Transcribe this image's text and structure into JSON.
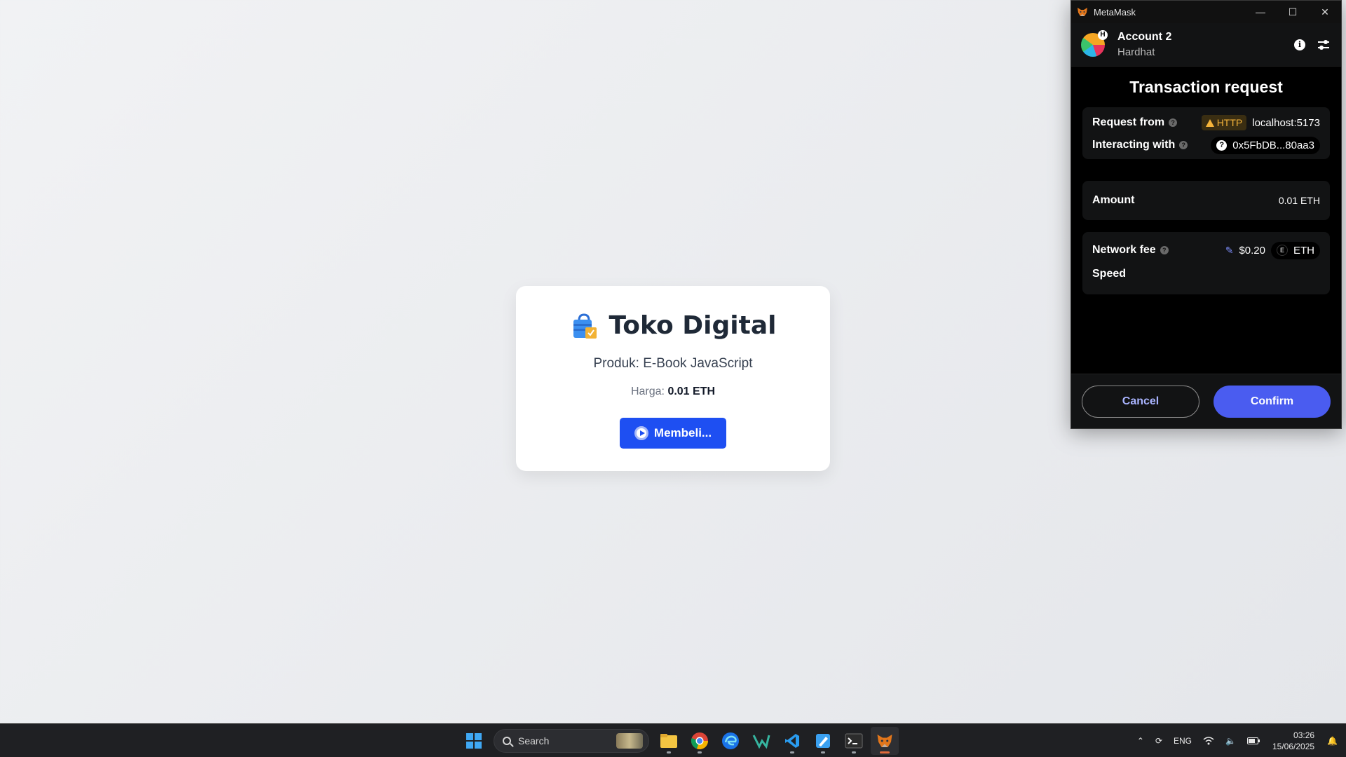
{
  "shop": {
    "title": "Toko Digital",
    "product_label": "Produk: E-Book JavaScript",
    "price_label": "Harga:",
    "price_value": "0.01 ETH",
    "buy_button_label": "Membeli..."
  },
  "metamask": {
    "window_title": "MetaMask",
    "account_name": "Account 2",
    "network_name": "Hardhat",
    "avatar_badge": "H",
    "heading": "Transaction request",
    "request_from_label": "Request from",
    "http_badge": "HTTP",
    "origin": "localhost:5173",
    "interacting_with_label": "Interacting with",
    "contract_address": "0x5FbDB...80aa3",
    "amount_label": "Amount",
    "amount_value": "0.01 ETH",
    "network_fee_label": "Network fee",
    "network_fee_value": "$0.20",
    "fee_token_letter": "E",
    "fee_token": "ETH",
    "speed_label": "Speed",
    "cancel_label": "Cancel",
    "confirm_label": "Confirm"
  },
  "taskbar": {
    "search_placeholder": "Search",
    "language": "ENG",
    "time": "03:26",
    "date": "15/06/2025",
    "apps": [
      "start-icon",
      "file-explorer-icon",
      "chrome-icon",
      "edge-icon",
      "visual-studio-icon",
      "vscode-icon",
      "paint-icon",
      "terminal-icon",
      "metamask-icon"
    ]
  },
  "colors": {
    "primary_button": "#1e4ff2",
    "metamask_confirm": "#4a5cf0",
    "http_warning": "#f5b43a"
  }
}
